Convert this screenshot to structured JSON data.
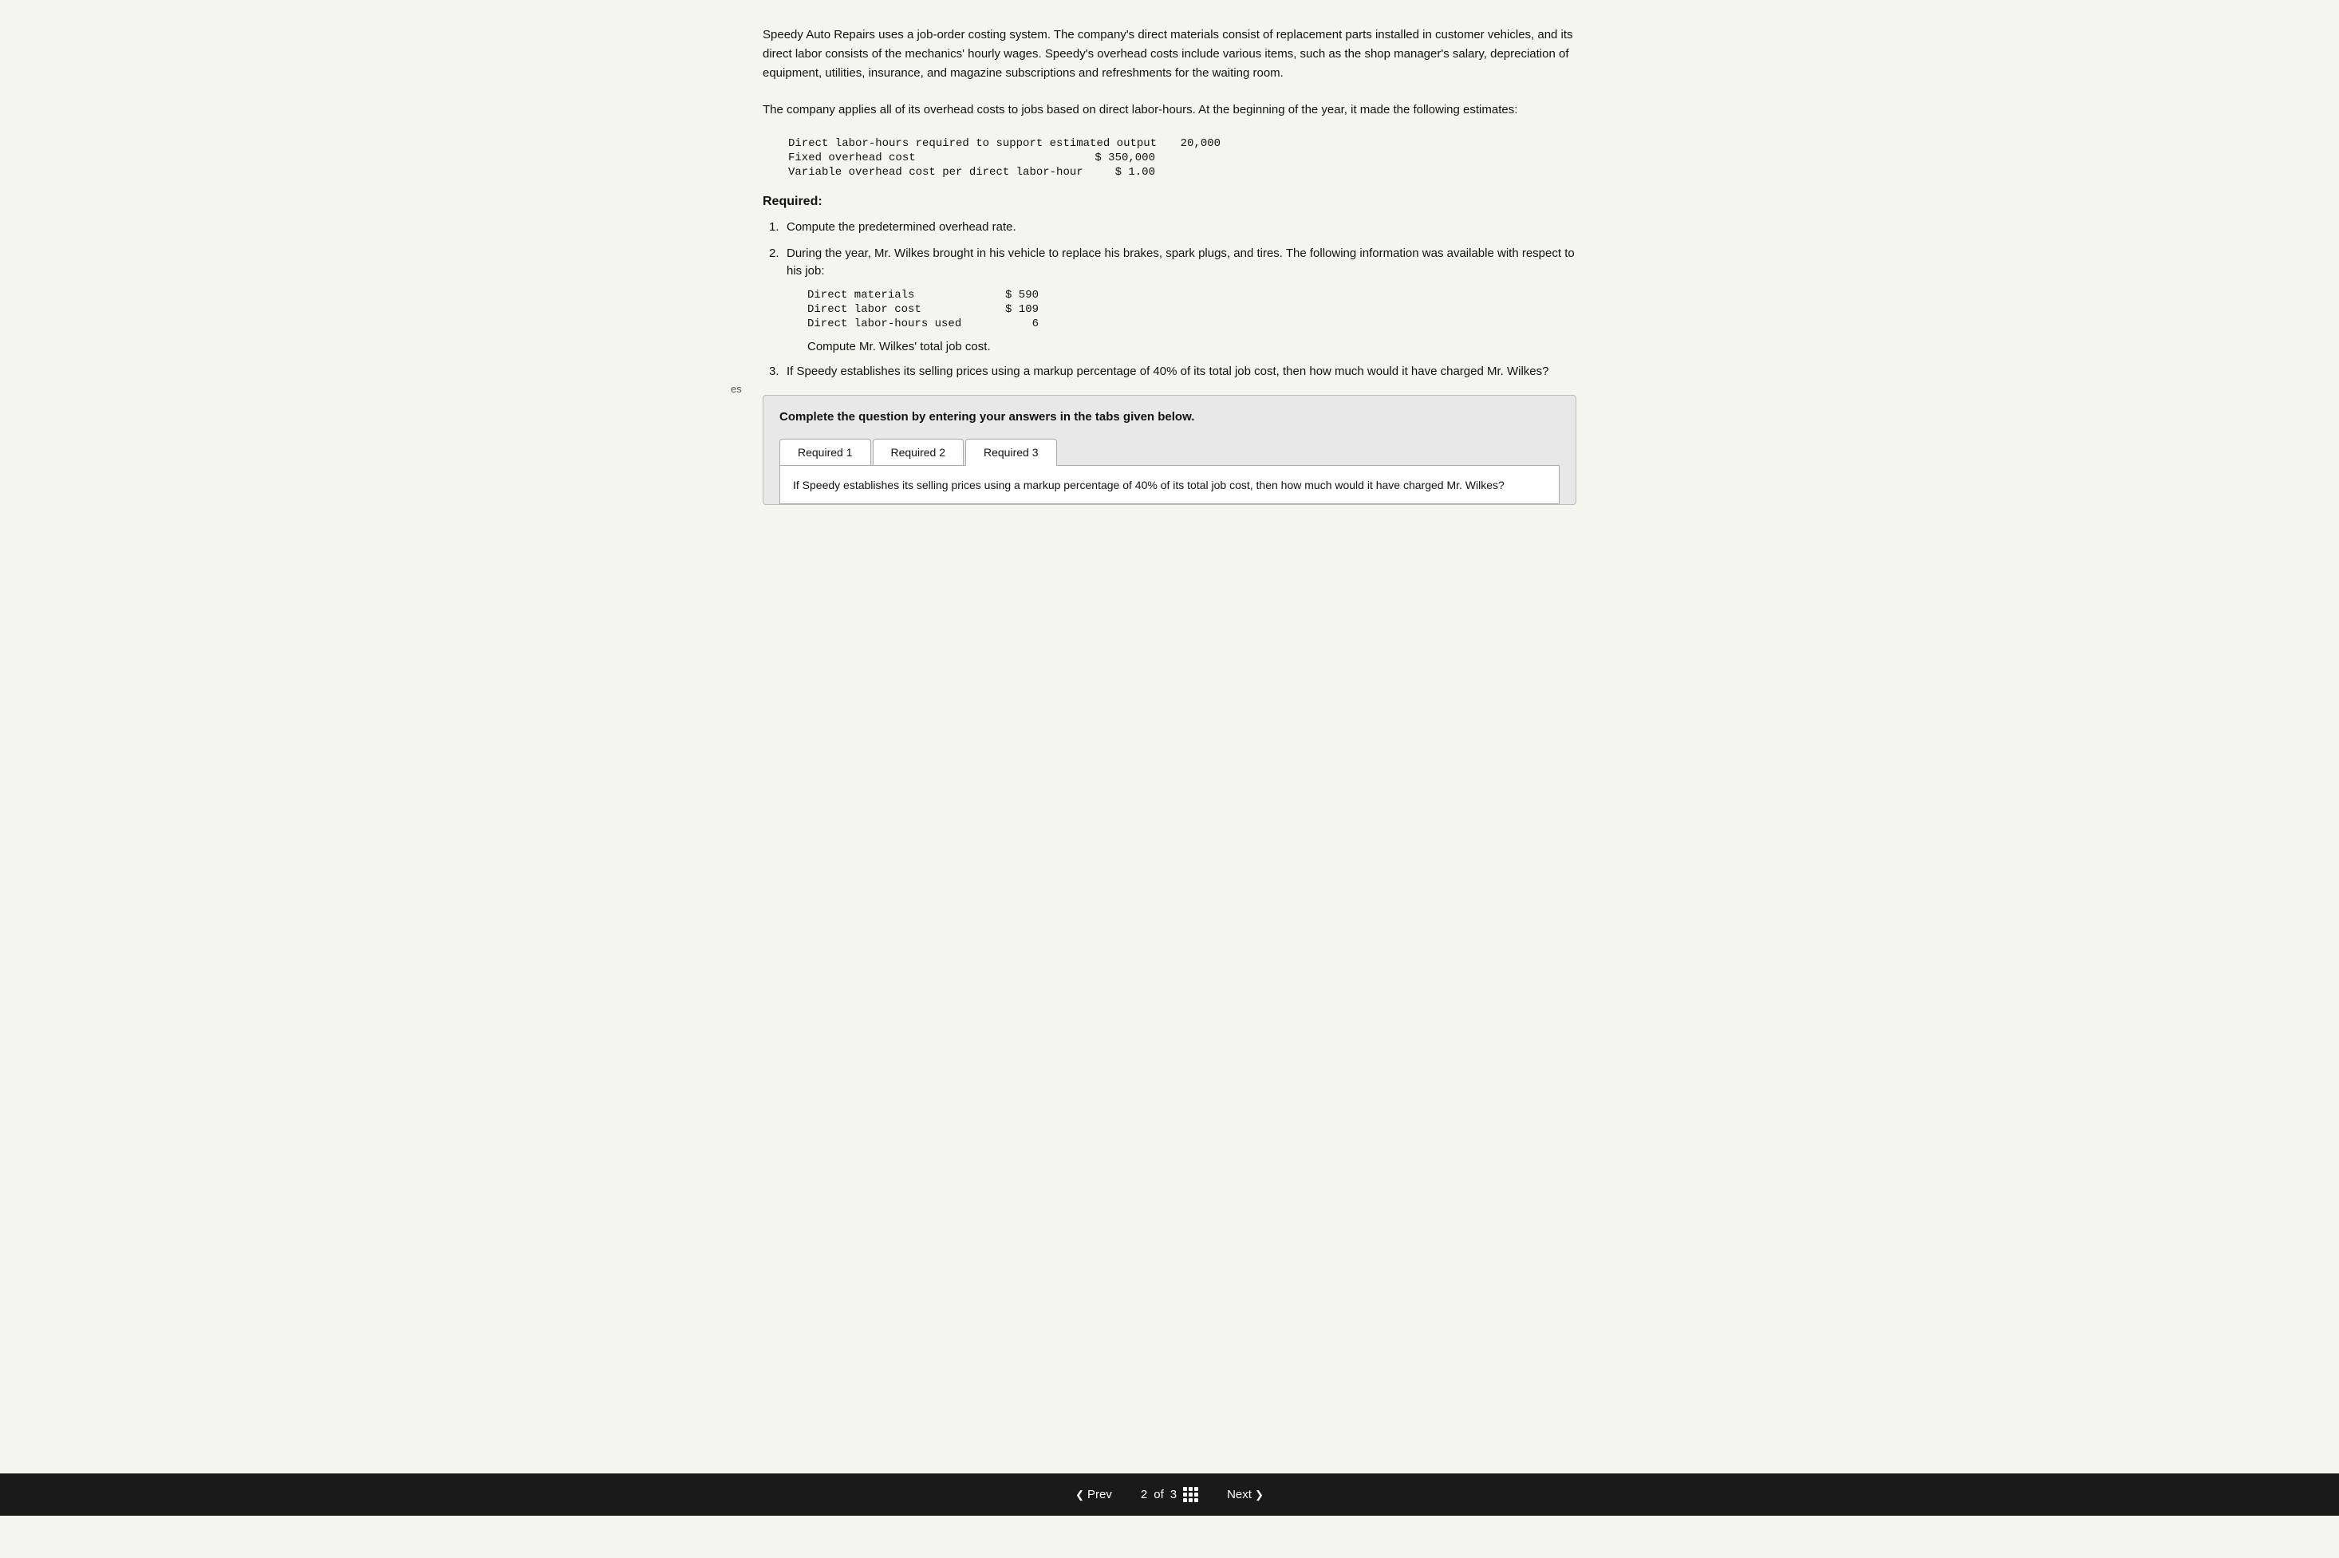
{
  "intro": {
    "paragraph1": "Speedy Auto Repairs uses a job-order costing system. The company's direct materials consist of replacement parts installed in customer vehicles, and its direct labor consists of the mechanics' hourly wages. Speedy's overhead costs include various items, such as the shop manager's salary, depreciation of equipment, utilities, insurance, and magazine subscriptions and refreshments for the waiting room.",
    "paragraph2": "The company applies all of its overhead costs to jobs based on direct labor-hours. At the beginning of the year, it made the following estimates:"
  },
  "estimates": {
    "rows": [
      {
        "label": "Direct labor-hours required to support estimated output",
        "value": "20,000"
      },
      {
        "label": "Fixed overhead cost",
        "value": "$ 350,000"
      },
      {
        "label": "Variable overhead cost per direct labor-hour",
        "value": "$ 1.00"
      }
    ]
  },
  "required_heading": "Required:",
  "requirements": [
    {
      "num": "1.",
      "text": "Compute the predetermined overhead rate."
    },
    {
      "num": "2.",
      "text": "During the year, Mr. Wilkes brought in his vehicle to replace his brakes, spark plugs, and tires. The following information was available with respect to his job:"
    }
  ],
  "job_details": [
    {
      "label": "Direct materials",
      "value": "$ 590"
    },
    {
      "label": "Direct labor cost",
      "value": "$ 109"
    },
    {
      "label": "Direct labor-hours used",
      "value": "6"
    }
  ],
  "compute_wilkes": "Compute Mr. Wilkes' total job cost.",
  "req3": {
    "num": "3.",
    "text": "If Speedy establishes its selling prices using a markup percentage of 40% of its total job cost, then how much would it have charged Mr. Wilkes?"
  },
  "complete_instruction": "Complete the question by entering your answers in the tabs given below.",
  "tabs": [
    {
      "id": "req1",
      "label": "Required 1",
      "active": false
    },
    {
      "id": "req2",
      "label": "Required 2",
      "active": false
    },
    {
      "id": "req3",
      "label": "Required 3",
      "active": true
    }
  ],
  "tab_content": "If Speedy establishes its selling prices using a markup percentage of 40% of its total job cost, then how much would it have charged Mr. Wilkes?",
  "bottom_bar": {
    "prev_label": "Prev",
    "page_current": "2",
    "page_separator": "of",
    "page_total": "3",
    "next_label": "Next"
  }
}
